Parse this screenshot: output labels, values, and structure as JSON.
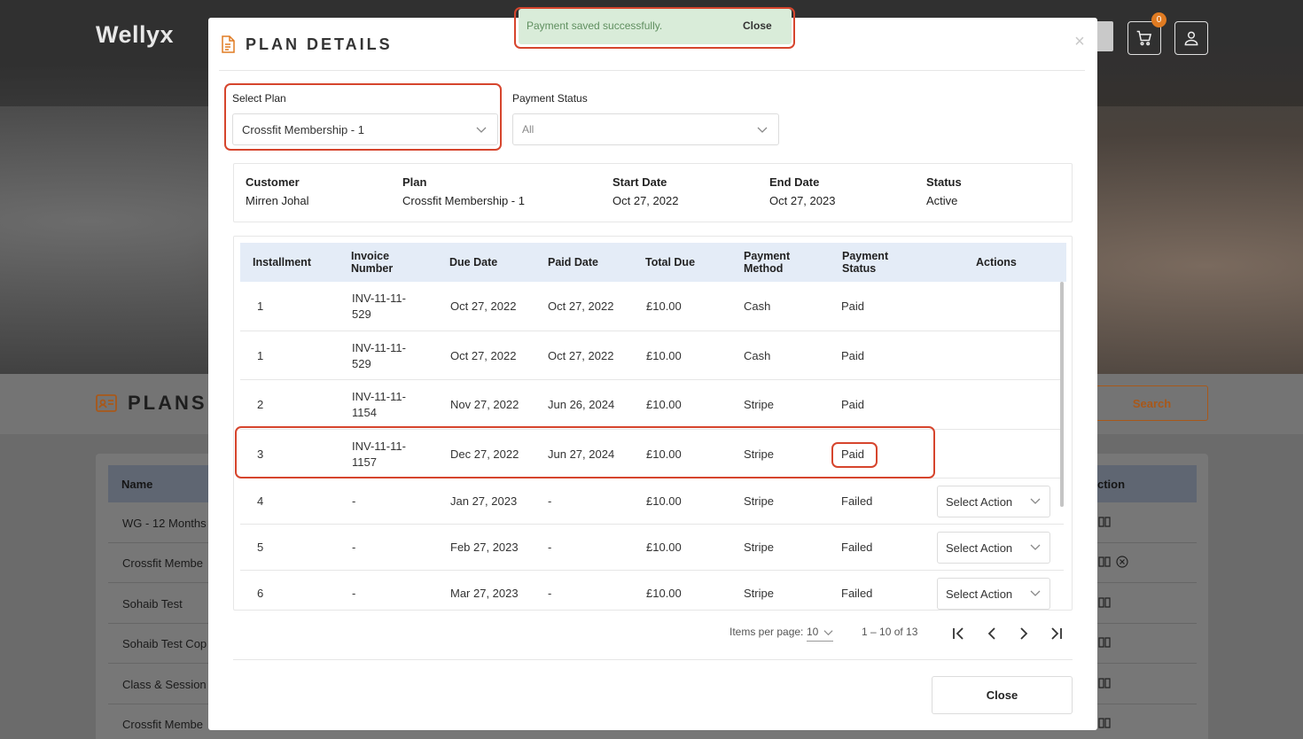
{
  "app": {
    "logo": "Wellyx",
    "cart_count": "0"
  },
  "background": {
    "section_title": "PLANS",
    "search_label": "Search",
    "table": {
      "name_header": "Name",
      "action_header": "ction",
      "rows": [
        "WG - 12 Months",
        "Crossfit Membe",
        "Sohaib Test",
        "Sohaib Test Cop",
        "Class & Session",
        "Crossfit Membe"
      ]
    }
  },
  "toast": {
    "message": "Payment saved successfully.",
    "close_label": "Close"
  },
  "modal": {
    "title": "PLAN DETAILS",
    "select_plan": {
      "label": "Select Plan",
      "value": "Crossfit Membership - 1"
    },
    "payment_status": {
      "label": "Payment Status",
      "value": "All"
    },
    "summary": {
      "customer": {
        "label": "Customer",
        "value": "Mirren Johal"
      },
      "plan": {
        "label": "Plan",
        "value": "Crossfit Membership - 1"
      },
      "start_date": {
        "label": "Start Date",
        "value": "Oct 27, 2022"
      },
      "end_date": {
        "label": "End Date",
        "value": "Oct 27, 2023"
      },
      "status": {
        "label": "Status",
        "value": "Active"
      }
    },
    "table": {
      "headers": {
        "installment": "Installment",
        "invoice_1": "Invoice",
        "invoice_2": "Number",
        "due_date": "Due Date",
        "paid_date": "Paid Date",
        "total_due": "Total Due",
        "method_1": "Payment",
        "method_2": "Method",
        "status_1": "Payment",
        "status_2": "Status",
        "actions": "Actions"
      },
      "rows": [
        {
          "installment": "1",
          "invoice_1": "INV-11-11-",
          "invoice_2": "529",
          "due_date": "Oct 27, 2022",
          "paid_date": "Oct 27, 2022",
          "total_due": "£10.00",
          "method": "Cash",
          "status": "Paid"
        },
        {
          "installment": "1",
          "invoice_1": "INV-11-11-",
          "invoice_2": "529",
          "due_date": "Oct 27, 2022",
          "paid_date": "Oct 27, 2022",
          "total_due": "£10.00",
          "method": "Cash",
          "status": "Paid"
        },
        {
          "installment": "2",
          "invoice_1": "INV-11-11-",
          "invoice_2": "1154",
          "due_date": "Nov 27, 2022",
          "paid_date": "Jun 26, 2024",
          "total_due": "£10.00",
          "method": "Stripe",
          "status": "Paid"
        },
        {
          "installment": "3",
          "invoice_1": "INV-11-11-",
          "invoice_2": "1157",
          "due_date": "Dec 27, 2022",
          "paid_date": "Jun 27, 2024",
          "total_due": "£10.00",
          "method": "Stripe",
          "status": "Paid"
        },
        {
          "installment": "4",
          "invoice_1": "-",
          "invoice_2": "",
          "due_date": "Jan 27, 2023",
          "paid_date": "-",
          "total_due": "£10.00",
          "method": "Stripe",
          "status": "Failed",
          "action": "Select Action"
        },
        {
          "installment": "5",
          "invoice_1": "-",
          "invoice_2": "",
          "due_date": "Feb 27, 2023",
          "paid_date": "-",
          "total_due": "£10.00",
          "method": "Stripe",
          "status": "Failed",
          "action": "Select Action"
        },
        {
          "installment": "6",
          "invoice_1": "-",
          "invoice_2": "",
          "due_date": "Mar 27, 2023",
          "paid_date": "-",
          "total_due": "£10.00",
          "method": "Stripe",
          "status": "Failed",
          "action": "Select Action"
        }
      ]
    },
    "pagination": {
      "items_per_page_label": "Items per page:",
      "page_size": "10",
      "range": "1 – 10 of 13"
    },
    "close_label": "Close"
  },
  "colors": {
    "highlight": "#d6452d",
    "accent": "#e07b22",
    "table_header_bg": "#e4ecf7",
    "toast_bg": "#d9ecd9"
  }
}
